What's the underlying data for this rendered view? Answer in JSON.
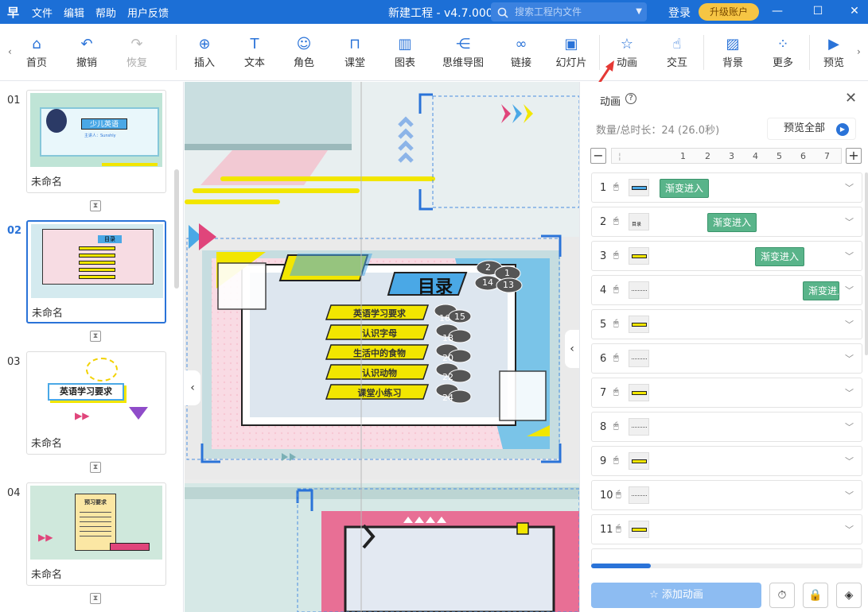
{
  "titlebar": {
    "logo": "早",
    "menu": [
      "文件",
      "编辑",
      "帮助",
      "用户反馈"
    ],
    "title": "新建工程 - v4.7.000",
    "search_placeholder": "搜索工程内文件",
    "login": "登录",
    "upgrade": "升级账户"
  },
  "toolbar": {
    "items": [
      {
        "label": "首页",
        "icon": "home-icon",
        "glyph": "⌂"
      },
      {
        "label": "撤销",
        "icon": "undo-icon",
        "glyph": "↶"
      },
      {
        "label": "恢复",
        "icon": "redo-icon",
        "glyph": "↷"
      },
      {
        "label": "插入",
        "icon": "plus-circle-icon",
        "glyph": "⊕"
      },
      {
        "label": "文本",
        "icon": "text-icon",
        "glyph": "T"
      },
      {
        "label": "角色",
        "icon": "person-icon",
        "glyph": "☺"
      },
      {
        "label": "课堂",
        "icon": "classroom-icon",
        "glyph": "⊓"
      },
      {
        "label": "图表",
        "icon": "chart-icon",
        "glyph": "▥"
      },
      {
        "label": "思维导图",
        "icon": "mindmap-icon",
        "glyph": "⋲"
      },
      {
        "label": "链接",
        "icon": "link-icon",
        "glyph": "∞"
      },
      {
        "label": "幻灯片",
        "icon": "slides-icon",
        "glyph": "▣"
      },
      {
        "label": "动画",
        "icon": "animation-star-icon",
        "glyph": "☆"
      },
      {
        "label": "交互",
        "icon": "interact-hand-icon",
        "glyph": "☝"
      },
      {
        "label": "背景",
        "icon": "background-icon",
        "glyph": "▨"
      },
      {
        "label": "更多",
        "icon": "more-grid-icon",
        "glyph": "⁘"
      },
      {
        "label": "预览",
        "icon": "preview-play-icon",
        "glyph": "▶"
      }
    ]
  },
  "slides": [
    {
      "num": "01",
      "name": "未命名",
      "thumb_title": "少儿英语",
      "thumb_sub": "主讲人：Sunshly"
    },
    {
      "num": "02",
      "name": "未命名",
      "thumb_title": "目录",
      "active": true
    },
    {
      "num": "03",
      "name": "未命名",
      "thumb_title": "英语学习要求"
    },
    {
      "num": "04",
      "name": "未命名",
      "thumb_title": "预习要求"
    }
  ],
  "canvas": {
    "toc_title": "目录",
    "toc_items": [
      "英语学习要求",
      "认识字母",
      "生活中的食物",
      "认识动物",
      "课堂小练习"
    ],
    "badges_top": [
      "2",
      "1",
      "14",
      "13"
    ],
    "badges_list": [
      "16",
      "15",
      "18",
      "20",
      "22",
      "24"
    ]
  },
  "panel": {
    "title": "动画",
    "help": "?",
    "count": "数量/总时长：24 (26.0秒)",
    "preview_all": "预览全部",
    "ruler_ticks": [
      "1",
      "2",
      "3",
      "4",
      "5",
      "6",
      "7"
    ],
    "rows": [
      {
        "num": "1",
        "thumb": "blue-bar",
        "tag": "渐变进入"
      },
      {
        "num": "2",
        "thumb": "目录",
        "tag": "渐变进入"
      },
      {
        "num": "3",
        "thumb": "yellow-bar",
        "tag": "渐变进入"
      },
      {
        "num": "4",
        "thumb": "text",
        "tag": "渐变进入"
      },
      {
        "num": "5",
        "thumb": "yellow-bar",
        "tag": ""
      },
      {
        "num": "6",
        "thumb": "text",
        "tag": ""
      },
      {
        "num": "7",
        "thumb": "yellow-bar",
        "tag": ""
      },
      {
        "num": "8",
        "thumb": "text",
        "tag": ""
      },
      {
        "num": "9",
        "thumb": "yellow-bar",
        "tag": ""
      },
      {
        "num": "10",
        "thumb": "text",
        "tag": ""
      },
      {
        "num": "11",
        "thumb": "yellow-bar",
        "tag": ""
      }
    ],
    "add_animation": "添加动画"
  },
  "colors": {
    "accent": "#1c6fd6",
    "tag_green": "#59b48a",
    "upgrade": "#f6c544"
  }
}
